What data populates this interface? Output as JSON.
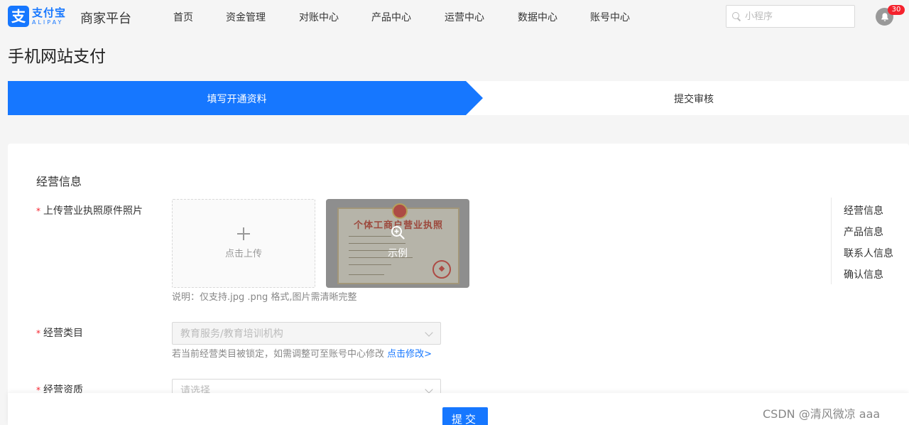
{
  "header": {
    "logo_mark": "支",
    "logo_cn": "支付宝",
    "logo_en": "ALIPAY",
    "platform": "商家平台",
    "nav": [
      "首页",
      "资金管理",
      "对账中心",
      "产品中心",
      "运营中心",
      "数据中心",
      "账号中心"
    ],
    "search_placeholder": "小程序",
    "notification_count": "30"
  },
  "page": {
    "title": "手机网站支付"
  },
  "steps": {
    "current": "填写开通资料",
    "next": "提交审核"
  },
  "form": {
    "section_title": "经营信息",
    "required_mark": "*",
    "license_label": "上传营业执照原件照片",
    "upload_text": "点击上传",
    "example_title": "个体工商户营业执照",
    "example_label": "示例",
    "upload_hint": "说明：仅支持.jpg .png 格式,图片需清晰完整",
    "category_label": "经营类目",
    "category_value": "教育服务/教育培训机构",
    "category_hint": "若当前经营类目被锁定，如需调整可至账号中心修改",
    "category_link": "点击修改>",
    "qualification_label": "经营资质",
    "qualification_placeholder": "请选择"
  },
  "anchors": [
    "经营信息",
    "产品信息",
    "联系人信息",
    "确认信息"
  ],
  "footer": {
    "submit": "提交"
  },
  "watermark": "CSDN @清风微凉 aaa",
  "colors": {
    "primary": "#1677ff",
    "danger": "#f5222d"
  }
}
